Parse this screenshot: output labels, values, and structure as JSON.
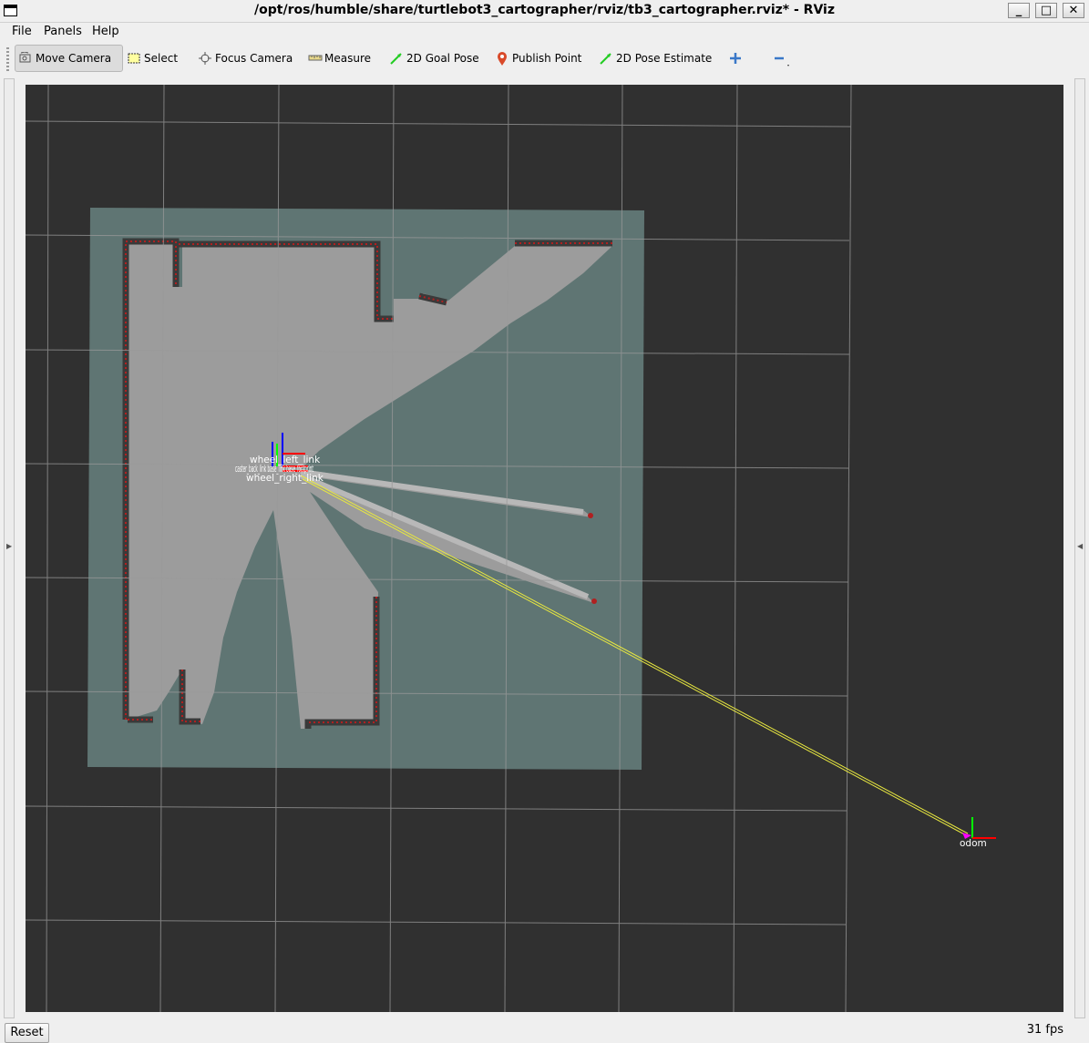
{
  "window": {
    "title": "/opt/ros/humble/share/turtlebot3_cartographer/rviz/tb3_cartographer.rviz* - RViz",
    "controls": {
      "minimize": "_",
      "maximize": "□",
      "close": "✕"
    }
  },
  "menubar": {
    "items": [
      {
        "label": "File"
      },
      {
        "label": "Panels"
      },
      {
        "label": "Help"
      }
    ]
  },
  "toolbar": {
    "tools": [
      {
        "label": "Move Camera",
        "icon": "move-camera-icon",
        "active": true
      },
      {
        "label": "Select",
        "icon": "select-icon"
      },
      {
        "label": "Focus Camera",
        "icon": "focus-camera-icon"
      },
      {
        "label": "Measure",
        "icon": "measure-icon"
      },
      {
        "label": "2D Goal Pose",
        "icon": "goal-pose-icon"
      },
      {
        "label": "Publish Point",
        "icon": "publish-point-icon"
      },
      {
        "label": "2D Pose Estimate",
        "icon": "pose-estimate-icon"
      }
    ],
    "add_tool_icon": "plus-icon",
    "remove_tool_icon": "minus-icon"
  },
  "viewport": {
    "frame_labels": {
      "wheel_left": "wheel_left_link",
      "base_stack": "caster_back_link base_link base_footprint",
      "caster": "caster",
      "wheel_right": "wheel_right_link",
      "odom": "odom"
    },
    "colors": {
      "background": "#303030",
      "grid": "#9a9a9a",
      "map_unknown": "#5f7573",
      "map_free": "#9c9c9c",
      "map_wall": "#3a3a3a",
      "laser": "#b02020",
      "tf_line": "#e8e840",
      "axis_x": "#ff0000",
      "axis_y": "#00ff00",
      "axis_z": "#0000ff"
    }
  },
  "statusbar": {
    "reset_label": "Reset",
    "fps_label": "31 fps"
  }
}
